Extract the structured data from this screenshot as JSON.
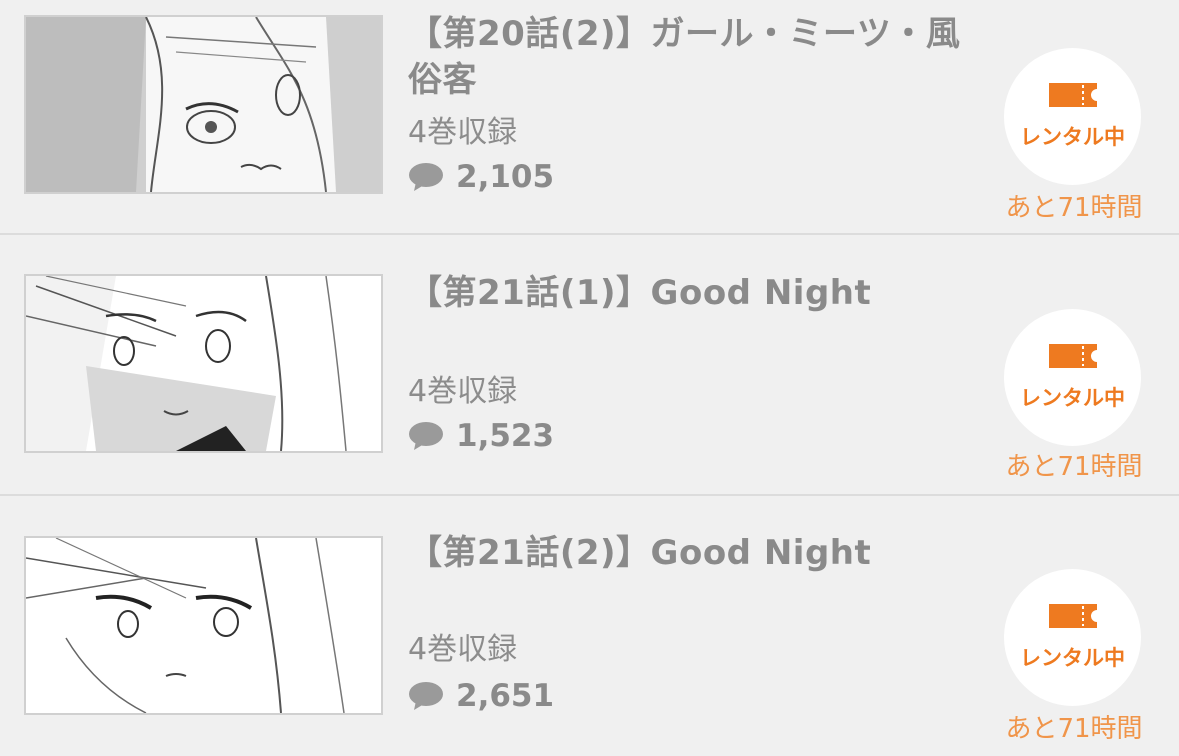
{
  "colors": {
    "background": "#f0f0f0",
    "title_text": "#8a8a8a",
    "accent_orange": "#ee7a20",
    "remaining_orange": "#f0954a",
    "divider": "#dcdcdc"
  },
  "episodes": [
    {
      "title": "【第20話(2)】ガール・ミーツ・風俗客",
      "volume": "4巻収録",
      "comments": "2,105",
      "rental_label": "レンタル中",
      "remaining": "あと71時間",
      "icons": [
        "comment-bubble-icon",
        "ticket-icon"
      ]
    },
    {
      "title": "【第21話(1)】Good Night",
      "volume": "4巻収録",
      "comments": "1,523",
      "rental_label": "レンタル中",
      "remaining": "あと71時間",
      "icons": [
        "comment-bubble-icon",
        "ticket-icon"
      ]
    },
    {
      "title": "【第21話(2)】Good Night",
      "volume": "4巻収録",
      "comments": "2,651",
      "rental_label": "レンタル中",
      "remaining": "あと71時間",
      "icons": [
        "comment-bubble-icon",
        "ticket-icon"
      ]
    }
  ]
}
